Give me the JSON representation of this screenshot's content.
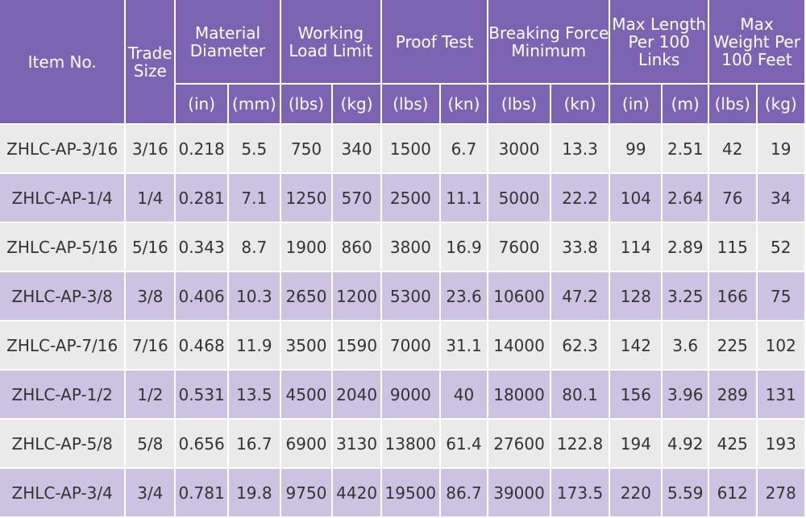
{
  "table": {
    "headers": {
      "item_no": "Item No.",
      "trade_size": [
        "Trade",
        "Size"
      ],
      "material_diameter": [
        "Material",
        "Diameter"
      ],
      "working_load_limit": [
        "Working",
        "Load Limit"
      ],
      "proof_test": "Proof Test",
      "breaking_force": [
        "Breaking Force",
        "Minimum"
      ],
      "max_length": [
        "Max Length",
        "Per 100",
        "Links"
      ],
      "max_weight": [
        "Max",
        "Weight Per",
        "100 Feet"
      ]
    },
    "units": [
      "(in)",
      "(mm)",
      "(lbs)",
      "(kg)",
      "(lbs)",
      "(kn)",
      "(lbs)",
      "(kn)",
      "(in)",
      "(m)",
      "(lbs)",
      "(kg)"
    ],
    "rows": [
      [
        "ZHLC-AP-3/16",
        "3/16",
        "0.218",
        "5.5",
        "750",
        "340",
        "1500",
        "6.7",
        "3000",
        "13.3",
        "99",
        "2.51",
        "42",
        "19"
      ],
      [
        "ZHLC-AP-1/4",
        "1/4",
        "0.281",
        "7.1",
        "1250",
        "570",
        "2500",
        "11.1",
        "5000",
        "22.2",
        "104",
        "2.64",
        "76",
        "34"
      ],
      [
        "ZHLC-AP-5/16",
        "5/16",
        "0.343",
        "8.7",
        "1900",
        "860",
        "3800",
        "16.9",
        "7600",
        "33.8",
        "114",
        "2.89",
        "115",
        "52"
      ],
      [
        "ZHLC-AP-3/8",
        "3/8",
        "0.406",
        "10.3",
        "2650",
        "1200",
        "5300",
        "23.6",
        "10600",
        "47.2",
        "128",
        "3.25",
        "166",
        "75"
      ],
      [
        "ZHLC-AP-7/16",
        "7/16",
        "0.468",
        "11.9",
        "3500",
        "1590",
        "7000",
        "31.1",
        "14000",
        "62.3",
        "142",
        "3.6",
        "225",
        "102"
      ],
      [
        "ZHLC-AP-1/2",
        "1/2",
        "0.531",
        "13.5",
        "4500",
        "2040",
        "9000",
        "40",
        "18000",
        "80.1",
        "156",
        "3.96",
        "289",
        "131"
      ],
      [
        "ZHLC-AP-5/8",
        "5/8",
        "0.656",
        "16.7",
        "6900",
        "3130",
        "13800",
        "61.4",
        "27600",
        "122.8",
        "194",
        "4.92",
        "425",
        "193"
      ],
      [
        "ZHLC-AP-3/4",
        "3/4",
        "0.781",
        "19.8",
        "9750",
        "4420",
        "19500",
        "86.7",
        "39000",
        "173.5",
        "220",
        "5.59",
        "612",
        "278"
      ]
    ]
  }
}
